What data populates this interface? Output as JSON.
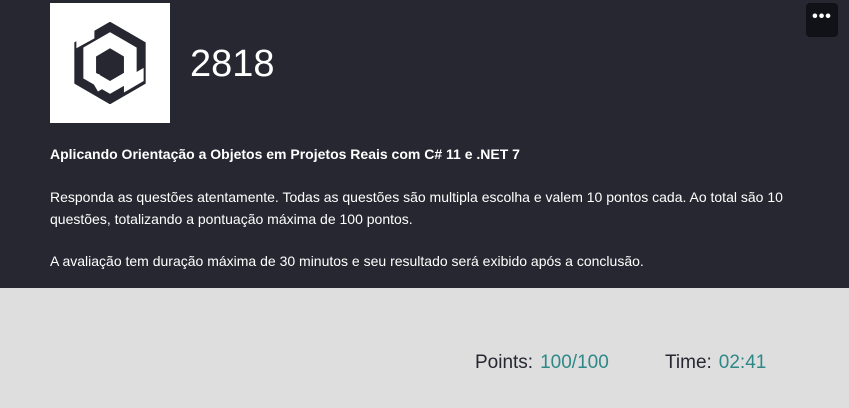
{
  "header": {
    "logo_icon": "hexagon-cube-icon",
    "course_code": "2818",
    "menu_icon": "more-horizontal-icon",
    "menu_label": "•••",
    "course_title": "Aplicando Orientação a Objetos em Projetos Reais com C# 11 e .NET 7",
    "instructions": "Responda as questões atentamente. Todas as questões são multipla escolha e valem 10 pontos cada. Ao total são 10 questões, totalizando a pontuação máxima de 100 pontos.",
    "duration_note": "A avaliação tem duração máxima de 30 minutos e seu resultado será exibido após a conclusão."
  },
  "stats": {
    "points_label": "Points:",
    "points_value": "100/100",
    "time_label": "Time:",
    "time_value": "02:41"
  },
  "colors": {
    "header_background": "#262730",
    "page_background": "#dedede",
    "accent": "#2f8888",
    "menu_button_background": "#111217"
  }
}
